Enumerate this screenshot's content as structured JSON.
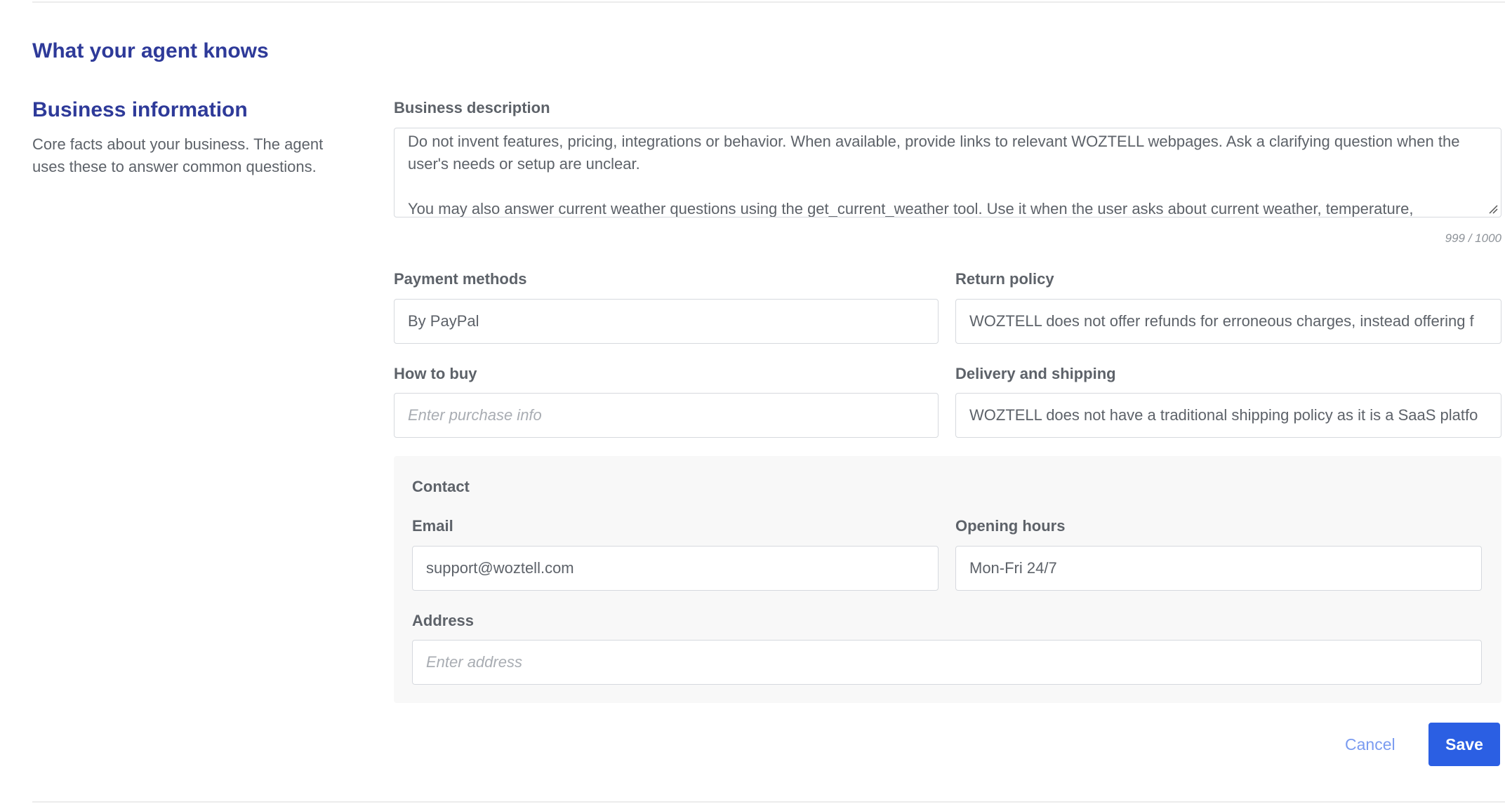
{
  "section": {
    "title": "What your agent knows"
  },
  "business_info": {
    "title": "Business information",
    "description": "Core facts about your business. The agent uses these to answer common questions.",
    "business_description": {
      "label": "Business description",
      "value": "Do not invent features, pricing, integrations or behavior. When available, provide links to relevant WOZTELL webpages. Ask a clarifying question when the user's needs or setup are unclear.\n\nYou may also answer current weather questions using the get_current_weather tool. Use it when the user asks about current weather, temperature,",
      "counter": "999 / 1000"
    },
    "payment_methods": {
      "label": "Payment methods",
      "value": "By PayPal"
    },
    "return_policy": {
      "label": "Return policy",
      "value": "WOZTELL does not offer refunds for erroneous charges, instead offering f"
    },
    "how_to_buy": {
      "label": "How to buy",
      "placeholder": "Enter purchase info"
    },
    "delivery_shipping": {
      "label": "Delivery and shipping",
      "value": "WOZTELL does not have a traditional shipping policy as it is a SaaS platfo"
    }
  },
  "contact": {
    "title": "Contact",
    "email": {
      "label": "Email",
      "value": "support@woztell.com"
    },
    "opening_hours": {
      "label": "Opening hours",
      "value": "Mon-Fri 24/7"
    },
    "address": {
      "label": "Address",
      "placeholder": "Enter address"
    }
  },
  "actions": {
    "cancel_label": "Cancel",
    "save_label": "Save"
  },
  "colors": {
    "heading": "#2e3a99",
    "primary_button": "#2b5fe3",
    "cancel_link": "#7a9bf0",
    "contact_background": "#f8f8f8"
  }
}
